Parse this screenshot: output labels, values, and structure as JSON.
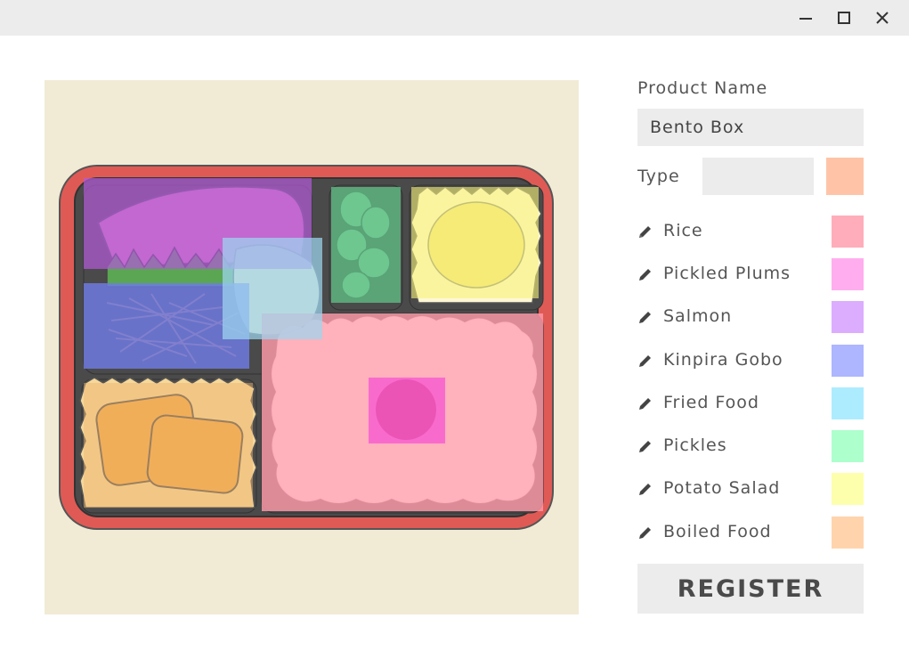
{
  "window": {
    "controls": [
      {
        "name": "minimize-button",
        "icon": "minimize-icon"
      },
      {
        "name": "maximize-button",
        "icon": "maximize-icon"
      },
      {
        "name": "close-button",
        "icon": "close-icon"
      }
    ]
  },
  "canvas": {
    "background": "#f1ebd6",
    "image": "bento-box-illustration"
  },
  "form": {
    "product_name_label": "Product Name",
    "product_name_value": "Bento Box",
    "type_label": "Type",
    "type_value": "",
    "type_color": "#ffc4a8"
  },
  "categories": [
    {
      "label": "Rice",
      "color": "#ffadba",
      "icon": "pencil-icon"
    },
    {
      "label": "Pickled Plums",
      "color": "#ffadee",
      "icon": "pencil-icon"
    },
    {
      "label": "Salmon",
      "color": "#dcadff",
      "icon": "pencil-icon"
    },
    {
      "label": "Kinpira Gobo",
      "color": "#adb6ff",
      "icon": "pencil-icon"
    },
    {
      "label": "Fried Food",
      "color": "#adecff",
      "icon": "pencil-icon"
    },
    {
      "label": "Pickles",
      "color": "#adffcc",
      "icon": "pencil-icon"
    },
    {
      "label": "Potato Salad",
      "color": "#fdffad",
      "icon": "pencil-icon"
    },
    {
      "label": "Boiled Food",
      "color": "#ffd4ad",
      "icon": "pencil-icon"
    }
  ],
  "register_label": "REGISTER"
}
